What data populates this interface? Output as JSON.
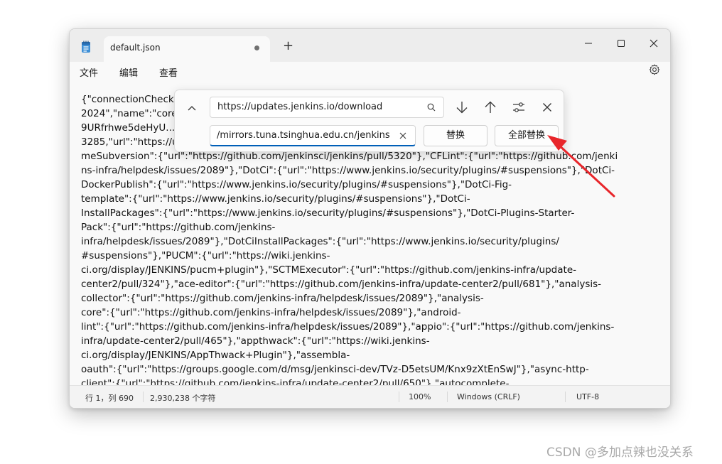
{
  "tab": {
    "title": "default.json",
    "new_tab": "+"
  },
  "menu": {
    "file": "文件",
    "edit": "编辑",
    "view": "查看"
  },
  "editor": {
    "lines": [
      "{\"connectionCheckUrl\":\"https://www.google.com/\",\"core\":{\"buildDate\":\"Jul 16,",
      "2024\",\"name\":\"core\",\"sha1\":\"\",\"sha256\":\"",
      "9URfrhwe5deHyU...\",\"size\":8706",
      "3285,\"url\":\"https://updates.jenkins.io/download/war/.../jenkins.war\"},\"deprecations\":{\"Bla",
      "meSubversion\":{\"url\":\"https://github.com/jenkinsci/jenkins/pull/5320\"},\"CFLint\":{\"url\":\"https://github.com/jenki",
      "ns-infra/helpdesk/issues/2089\"},\"DotCi\":{\"url\":\"https://www.jenkins.io/security/plugins/#suspensions\"},\"DotCi-",
      "DockerPublish\":{\"url\":\"https://www.jenkins.io/security/plugins/#suspensions\"},\"DotCi-Fig-",
      "template\":{\"url\":\"https://www.jenkins.io/security/plugins/#suspensions\"},\"DotCi-",
      "InstallPackages\":{\"url\":\"https://www.jenkins.io/security/plugins/#suspensions\"},\"DotCi-Plugins-Starter-",
      "Pack\":{\"url\":\"https://github.com/jenkins-",
      "infra/helpdesk/issues/2089\"},\"DotCiInstallPackages\":{\"url\":\"https://www.jenkins.io/security/plugins/",
      "#suspensions\"},\"PUCM\":{\"url\":\"https://wiki.jenkins-",
      "ci.org/display/JENKINS/pucm+plugin\"},\"SCTMExecutor\":{\"url\":\"https://github.com/jenkins-infra/update-",
      "center2/pull/324\"},\"ace-editor\":{\"url\":\"https://github.com/jenkins-infra/update-center2/pull/681\"},\"analysis-",
      "collector\":{\"url\":\"https://github.com/jenkins-infra/helpdesk/issues/2089\"},\"analysis-",
      "core\":{\"url\":\"https://github.com/jenkins-infra/helpdesk/issues/2089\"},\"android-",
      "lint\":{\"url\":\"https://github.com/jenkins-infra/helpdesk/issues/2089\"},\"appio\":{\"url\":\"https://github.com/jenkins-",
      "infra/update-center2/pull/465\"},\"appthwack\":{\"url\":\"https://wiki.jenkins-",
      "ci.org/display/JENKINS/AppThwack+Plugin\"},\"assembla-",
      "oauth\":{\"url\":\"https://groups.google.com/d/msg/jenkinsci-dev/TVz-D5etsUM/Knx9zXtEnSwJ\"},\"async-http-",
      "client\":{\"url\":\"https://github.com/jenkins-infra/update-center2/pull/650\"},\"autocomplete-"
    ]
  },
  "find": {
    "find_value": "https://updates.jenkins.io/download",
    "replace_value": "/mirrors.tuna.tsinghua.edu.cn/jenkins",
    "replace_label": "替换",
    "replace_all_label": "全部替换"
  },
  "status": {
    "position": "行 1，列 690",
    "char_count": "2,930,238 个字符",
    "zoom": "100%",
    "line_ending": "Windows (CRLF)",
    "encoding": "UTF-8"
  },
  "watermark": "CSDN @多加点辣也没关系",
  "colors": {
    "accent": "#005fb8",
    "arrow": "#e8262b"
  }
}
